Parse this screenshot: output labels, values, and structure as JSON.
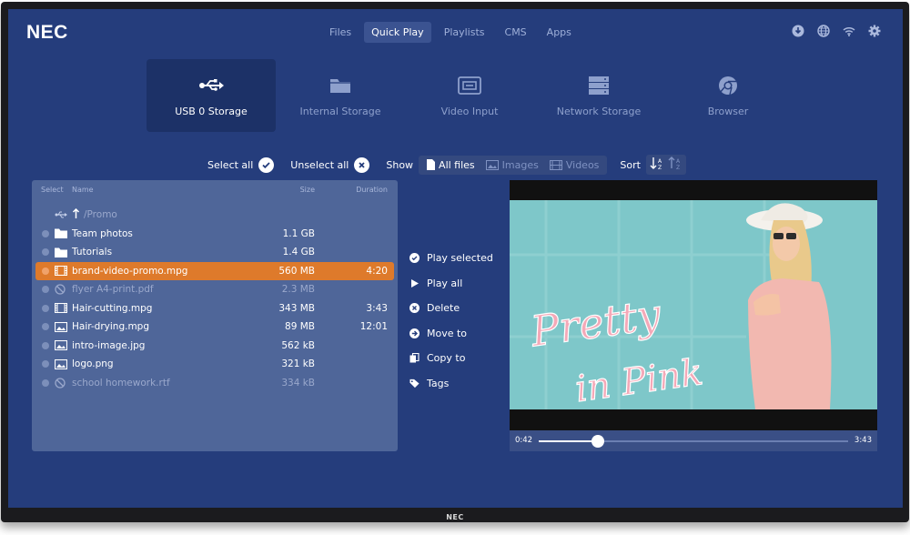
{
  "brand": {
    "logo": "NEC",
    "bezel_logo": "NEC"
  },
  "nav": {
    "tabs": [
      "Files",
      "Quick Play",
      "Playlists",
      "CMS",
      "Apps"
    ],
    "active": "Quick Play"
  },
  "tray": {
    "icons": [
      "download-icon",
      "globe-icon",
      "wifi-icon",
      "gear-icon"
    ]
  },
  "sources": [
    {
      "label": "USB 0 Storage",
      "icon": "usb-icon",
      "active": true
    },
    {
      "label": "Internal Storage",
      "icon": "folder-icon",
      "active": false
    },
    {
      "label": "Video Input",
      "icon": "video-input-icon",
      "active": false
    },
    {
      "label": "Network Storage",
      "icon": "network-storage-icon",
      "active": false
    },
    {
      "label": "Browser",
      "icon": "browser-icon",
      "active": false
    }
  ],
  "toolbar": {
    "select_all": "Select all",
    "unselect_all": "Unselect all",
    "show_label": "Show",
    "filters": [
      {
        "label": "All files",
        "active": true
      },
      {
        "label": "Images",
        "active": false
      },
      {
        "label": "Videos",
        "active": false
      }
    ],
    "sort_label": "Sort"
  },
  "file_list": {
    "headers": {
      "select": "Select",
      "name": "Name",
      "size": "Size",
      "duration": "Duration"
    },
    "path": "/Promo",
    "rows": [
      {
        "name": "Team photos",
        "size": "1.1 GB",
        "duration": "",
        "type": "folder",
        "state": "normal"
      },
      {
        "name": "Tutorials",
        "size": "1.4 GB",
        "duration": "",
        "type": "folder",
        "state": "normal"
      },
      {
        "name": "brand-video-promo.mpg",
        "size": "560 MB",
        "duration": "4:20",
        "type": "video",
        "state": "selected"
      },
      {
        "name": "flyer A4-print.pdf",
        "size": "2.3 MB",
        "duration": "",
        "type": "blocked",
        "state": "dim"
      },
      {
        "name": "Hair-cutting.mpg",
        "size": "343 MB",
        "duration": "3:43",
        "type": "video",
        "state": "normal"
      },
      {
        "name": "Hair-drying.mpg",
        "size": "89 MB",
        "duration": "12:01",
        "type": "image",
        "state": "normal"
      },
      {
        "name": "intro-image.jpg",
        "size": "562 kB",
        "duration": "",
        "type": "image",
        "state": "normal"
      },
      {
        "name": "logo.png",
        "size": "321 kB",
        "duration": "",
        "type": "image",
        "state": "normal"
      },
      {
        "name": "school homework.rtf",
        "size": "334 kB",
        "duration": "",
        "type": "blocked",
        "state": "dim"
      }
    ]
  },
  "actions": [
    {
      "label": "Play selected",
      "icon": "check-circle-icon"
    },
    {
      "label": "Play all",
      "icon": "play-icon"
    },
    {
      "label": "Delete",
      "icon": "delete-icon"
    },
    {
      "label": "Move to",
      "icon": "arrow-right-icon"
    },
    {
      "label": "Copy to",
      "icon": "copy-icon"
    },
    {
      "label": "Tags",
      "icon": "tag-icon"
    }
  ],
  "player": {
    "current_time": "0:42",
    "total_time": "3:43",
    "progress": 0.19,
    "overlay_line1": "Pretty",
    "overlay_line2": "in Pink"
  },
  "colors": {
    "screen_bg": "#253d7c",
    "selected_row": "#de7a2b",
    "panel": "#4f6699",
    "video_bg": "#7ec7c9",
    "overlay_text": "#f4a9b8"
  }
}
